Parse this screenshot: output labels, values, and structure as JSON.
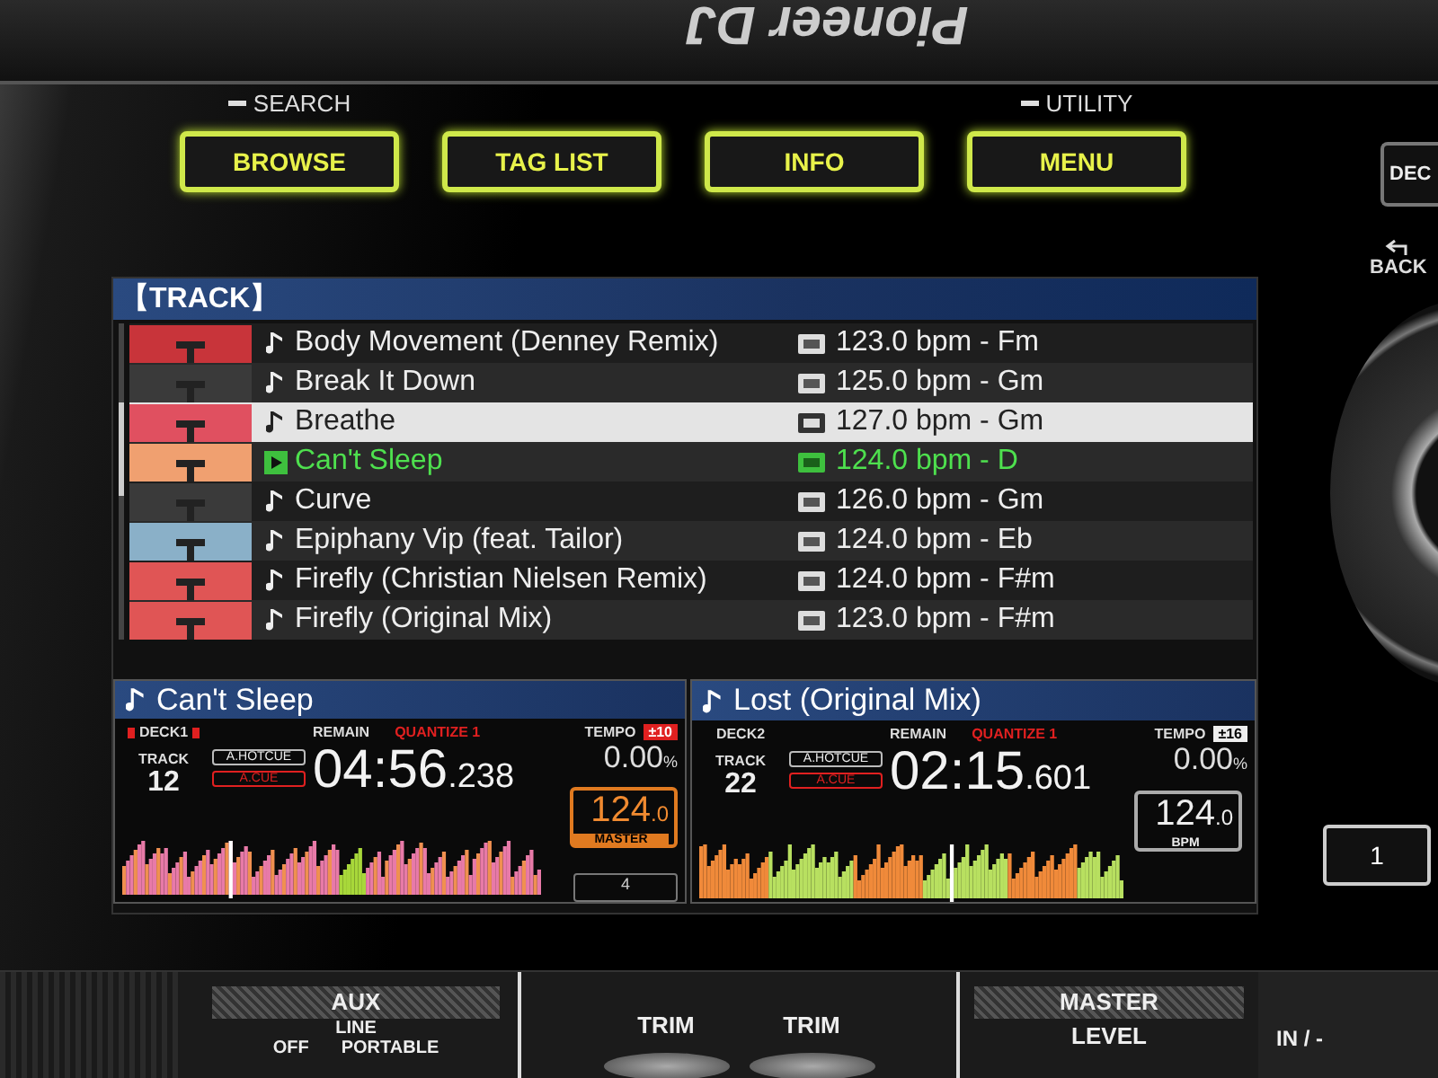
{
  "brand": "Pioneer DJ",
  "buttons": [
    {
      "label": "BROWSE",
      "caption": "SEARCH"
    },
    {
      "label": "TAG LIST"
    },
    {
      "label": "INFO"
    },
    {
      "label": "MENU",
      "caption": "UTILITY"
    }
  ],
  "side": {
    "deck_button": "DEC",
    "back": "BACK",
    "pad_button": "1"
  },
  "browser": {
    "title": "【TRACK】",
    "tracks": [
      {
        "title": "Body Movement (Denney Remix)",
        "info": "123.0 bpm - Fm",
        "selected": false,
        "playing": false,
        "color": "#c8343a"
      },
      {
        "title": "Break It Down",
        "info": "125.0 bpm - Gm",
        "selected": false,
        "playing": false,
        "color": "#3a3a3a"
      },
      {
        "title": "Breathe",
        "info": "127.0 bpm - Gm",
        "selected": true,
        "playing": false,
        "color": "#e05060"
      },
      {
        "title": "Can't Sleep",
        "info": "124.0 bpm - D",
        "selected": false,
        "playing": true,
        "color": "#f0a070"
      },
      {
        "title": "Curve",
        "info": "126.0 bpm - Gm",
        "selected": false,
        "playing": false,
        "color": "#3a3a3a"
      },
      {
        "title": "Epiphany Vip (feat. Tailor)",
        "info": "124.0 bpm - Eb",
        "selected": false,
        "playing": false,
        "color": "#8ab0c8"
      },
      {
        "title": "Firefly (Christian Nielsen Remix)",
        "info": "124.0 bpm - F#m",
        "selected": false,
        "playing": false,
        "color": "#e05555"
      },
      {
        "title": "Firefly (Original Mix)",
        "info": "123.0 bpm - F#m",
        "selected": false,
        "playing": false,
        "color": "#e05555"
      }
    ]
  },
  "decks": [
    {
      "title": "Can't Sleep",
      "deck": "DECK1",
      "on_air": true,
      "track_label": "TRACK",
      "track": "12",
      "hotcue": "A.HOTCUE",
      "cue": "A.CUE",
      "remain": "REMAIN",
      "quantize": "QUANTIZE 1",
      "time": "04:56",
      "ms": ".238",
      "tempo_label": "TEMPO",
      "range": "±10",
      "tempo": "0.00",
      "unit": "%",
      "bpm": "124",
      "bpm_dec": ".0",
      "master": true,
      "bpm_label": "MASTER",
      "beat": "4"
    },
    {
      "title": "Lost (Original Mix)",
      "deck": "DECK2",
      "on_air": false,
      "track_label": "TRACK",
      "track": "22",
      "hotcue": "A.HOTCUE",
      "cue": "A.CUE",
      "remain": "REMAIN",
      "quantize": "QUANTIZE 1",
      "time": "02:15",
      "ms": ".601",
      "tempo_label": "TEMPO",
      "range": "±16",
      "tempo": "0.00",
      "unit": "%",
      "bpm": "124",
      "bpm_dec": ".0",
      "master": false,
      "bpm_label": "BPM"
    }
  ],
  "mixer": {
    "aux": "AUX",
    "line": "LINE",
    "off": "OFF",
    "portable": "PORTABLE",
    "trims": [
      "TRIM",
      "TRIM"
    ],
    "master": "MASTER",
    "level": "LEVEL",
    "input": "IN / -"
  }
}
